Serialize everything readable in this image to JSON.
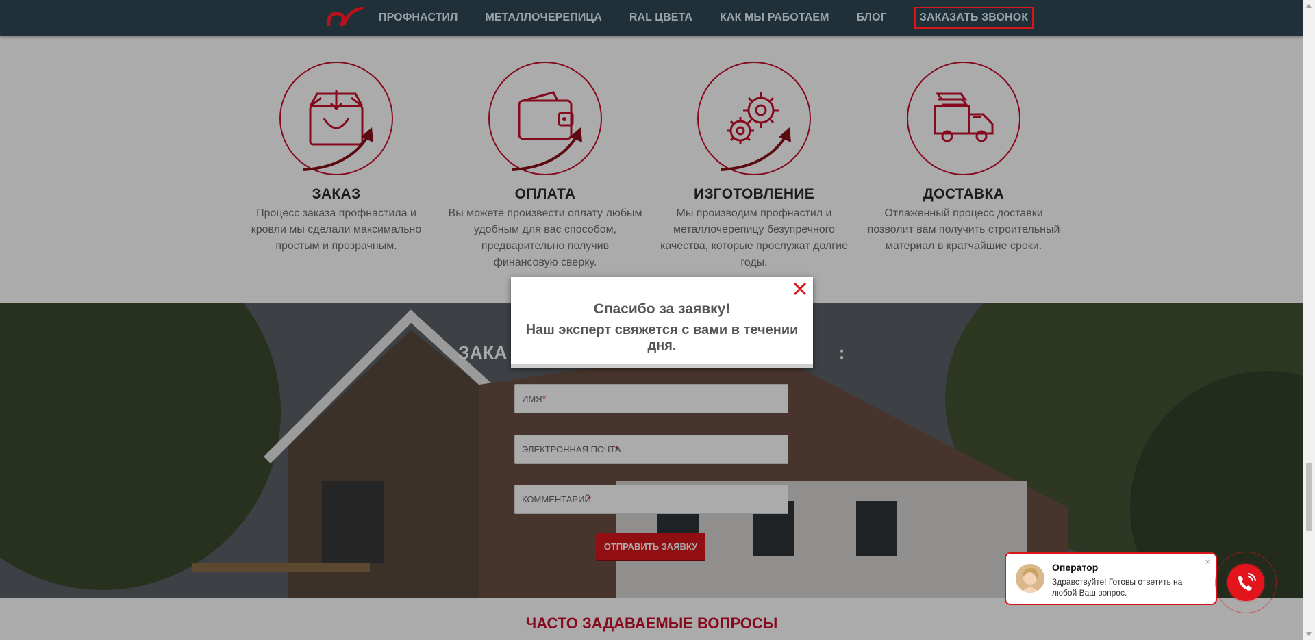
{
  "header": {
    "nav": [
      "ПРОФНАСТИЛ",
      "МЕТАЛЛОЧЕРЕПИЦА",
      "RAL ЦВЕТА",
      "КАК МЫ РАБОТАЕМ",
      "БЛОГ"
    ],
    "cta": "ЗАКАЗАТЬ ЗВОНОК",
    "logo_icon": "brand-logo-icon"
  },
  "steps": [
    {
      "title": "ЗАКАЗ",
      "text": "Процесс заказа профнастила и кровли мы сделали максимально простым и прозрачным.",
      "icon": "shopping-bag-icon"
    },
    {
      "title": "ОПЛАТА",
      "text": "Вы можете произвести оплату любым удобным для вас способом, предварительно получив финансовую сверку.",
      "icon": "wallet-icon"
    },
    {
      "title": "ИЗГОТОВЛЕНИЕ",
      "text": "Мы производим профнастил и металлочерепицу безупречного качества, которые прослужат долгие годы.",
      "icon": "gears-icon"
    },
    {
      "title": "ДОСТАВКА",
      "text": "Отлаженный процесс доставки позволит вам получить строительный материал в кратчайшие сроки.",
      "icon": "delivery-truck-icon"
    }
  ],
  "form": {
    "title_visible": "ЗАКА",
    "title_tail": ":",
    "name_placeholder": "ИМЯ",
    "email_placeholder": "ЭЛЕКТРОННАЯ ПОЧТА",
    "comment_placeholder": "КОММЕНТАРИЙ",
    "required_mark": "*",
    "submit": "ОТПРАВИТЬ ЗАЯВКУ"
  },
  "faq": {
    "title": "ЧАСТО ЗАДАВАЕМЫЕ ВОПРОСЫ"
  },
  "modal": {
    "line1": "Спасибо за заявку!",
    "line2": "Наш эксперт свяжется с вами в течении дня."
  },
  "chat": {
    "name": "Оператор",
    "text": "Здравствуйте! Готовы ответить на любой Ваш вопрос.",
    "close": "×"
  },
  "colors": {
    "accent": "#d9151c",
    "header_bg": "#1f3038",
    "step_red": "#c8102e"
  }
}
